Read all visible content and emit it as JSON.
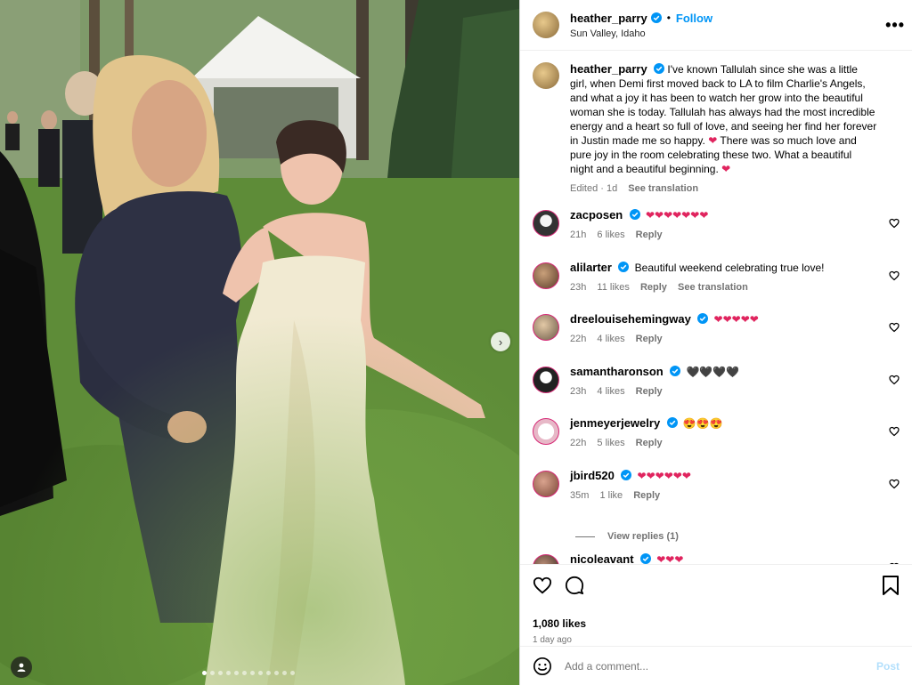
{
  "post": {
    "username": "heather_parry",
    "follow_label": "Follow",
    "location": "Sun Valley, Idaho",
    "more_label": "•••"
  },
  "caption": {
    "username": "heather_parry",
    "text": "I've known Tallulah since she was a little girl, when Demi first moved back to LA to film Charlie's Angels, and what a joy it has been to watch her grow into the beautiful woman she is today. Tallulah has always had the most incredible energy and a heart so full of love, and seeing her find her forever in Justin made me so happy. ❤ There was so much love and pure joy in the room celebrating these two. What a beautiful night and a beautiful beginning. ❤",
    "edited": "Edited · 1d",
    "see_translation": "See translation"
  },
  "comments": [
    {
      "username": "zacposen",
      "text": "❤❤❤❤❤❤❤",
      "time": "21h",
      "likes": "6 likes",
      "reply": "Reply",
      "translate": ""
    },
    {
      "username": "alilarter",
      "text": "Beautiful weekend celebrating true love!",
      "time": "23h",
      "likes": "11 likes",
      "reply": "Reply",
      "translate": "See translation"
    },
    {
      "username": "dreelouisehemingway",
      "text": "❤❤❤❤❤",
      "time": "22h",
      "likes": "4 likes",
      "reply": "Reply",
      "translate": ""
    },
    {
      "username": "samantharonson",
      "text": "🖤🖤🖤🖤",
      "time": "23h",
      "likes": "4 likes",
      "reply": "Reply",
      "translate": ""
    },
    {
      "username": "jenmeyerjewelry",
      "text": "😍😍😍",
      "time": "22h",
      "likes": "5 likes",
      "reply": "Reply",
      "translate": ""
    },
    {
      "username": "jbird520",
      "text": "❤❤❤❤❤❤",
      "time": "35m",
      "likes": "1 like",
      "reply": "Reply",
      "translate": ""
    },
    {
      "username": "nicoleavant",
      "text": "❤❤❤",
      "time": "",
      "likes": "",
      "reply": "",
      "translate": ""
    }
  ],
  "view_replies": "View replies (1)",
  "likes_count": "1,080 likes",
  "posted_ago": "1 day ago",
  "add_comment": {
    "placeholder": "Add a comment...",
    "post_label": "Post"
  },
  "photo_nav": {
    "next": "›"
  },
  "colors": {
    "heart": "#e0245e",
    "link": "#0095f6",
    "verified": "#0095f6"
  },
  "icons": [
    "verified-badge-icon",
    "heart-icon",
    "comment-icon",
    "save-icon",
    "emoji-icon",
    "chevron-right-icon",
    "tag-user-icon"
  ]
}
